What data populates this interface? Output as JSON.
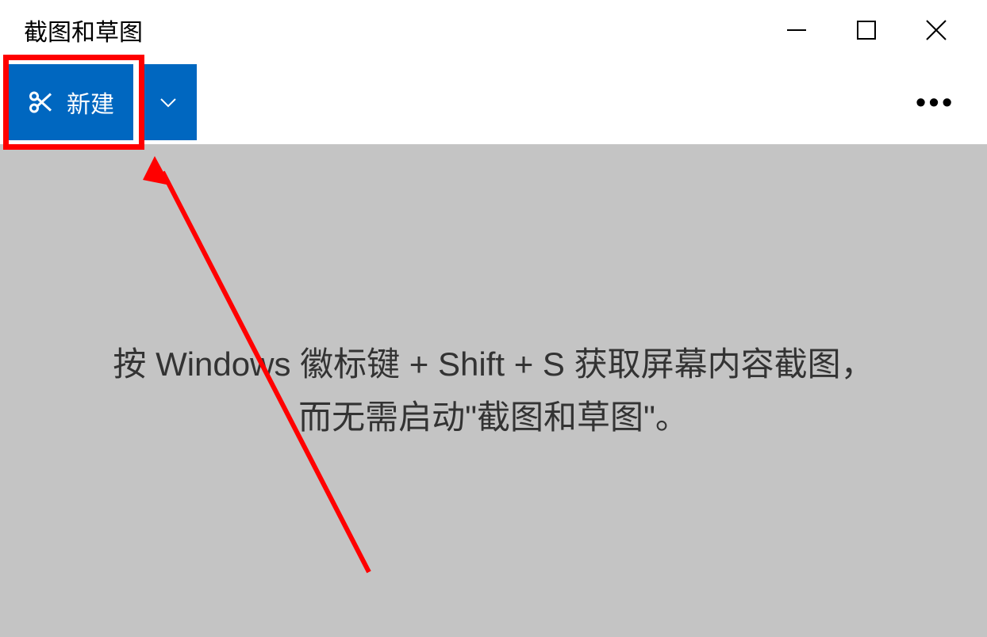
{
  "window": {
    "title": "截图和草图"
  },
  "toolbar": {
    "new_label": "新建"
  },
  "content": {
    "instruction_line1": "按 Windows 徽标键 + Shift + S 获取屏幕内容截图，",
    "instruction_line2": "而无需启动\"截图和草图\"。"
  }
}
